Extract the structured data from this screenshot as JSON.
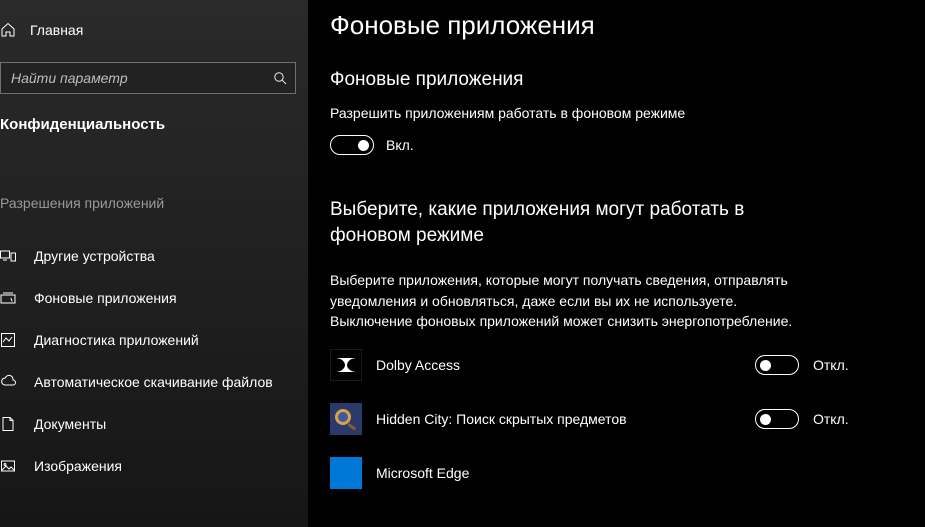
{
  "sidebar": {
    "home_label": "Главная",
    "search_placeholder": "Найти параметр",
    "category_label": "Конфиденциальность",
    "section_label": "Разрешения приложений",
    "items": [
      {
        "label": "Другие устройства"
      },
      {
        "label": "Фоновые приложения"
      },
      {
        "label": "Диагностика приложений"
      },
      {
        "label": "Автоматическое скачивание файлов"
      },
      {
        "label": "Документы"
      },
      {
        "label": "Изображения"
      }
    ]
  },
  "main": {
    "page_title": "Фоновые приложения",
    "section1_title": "Фоновые приложения",
    "section1_desc": "Разрешить приложениям работать в фоновом режиме",
    "master_toggle_label": "Вкл.",
    "section2_title": "Выберите, какие приложения могут работать в фоновом режиме",
    "section2_desc": "Выберите приложения, которые могут получать сведения, отправлять уведомления и обновляться, даже если вы их не используете. Выключение фоновых приложений может снизить энергопотребление.",
    "off_label": "Откл.",
    "apps": [
      {
        "name": "Dolby Access",
        "state": "off"
      },
      {
        "name": "Hidden City: Поиск скрытых предметов",
        "state": "off"
      },
      {
        "name": "Microsoft Edge",
        "state": "off"
      }
    ]
  }
}
